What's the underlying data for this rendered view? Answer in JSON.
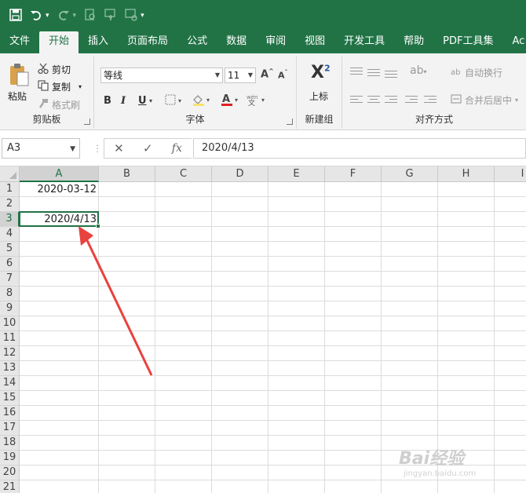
{
  "tabs": [
    "文件",
    "开始",
    "插入",
    "页面布局",
    "公式",
    "数据",
    "审阅",
    "视图",
    "开发工具",
    "帮助",
    "PDF工具集",
    "Ac"
  ],
  "active_tab": "开始",
  "clipboard": {
    "paste": "粘贴",
    "cut": "剪切",
    "copy": "复制",
    "format_painter": "格式刷",
    "label": "剪贴板"
  },
  "font": {
    "name": "等线",
    "size": "11",
    "bold": "B",
    "italic": "I",
    "underline": "U",
    "label": "字体"
  },
  "new_group": {
    "superscript": "上标",
    "label": "新建组"
  },
  "alignment": {
    "wrap_text": "自动换行",
    "merge_center": "合并后居中",
    "label": "对齐方式"
  },
  "formula_bar": {
    "name_box": "A3",
    "cancel_glyph": "✕",
    "enter_glyph": "✓",
    "fx_glyph": "fx",
    "value": "2020/4/13"
  },
  "columns": [
    "A",
    "B",
    "C",
    "D",
    "E",
    "F",
    "G",
    "H",
    "I"
  ],
  "selected_column": "A",
  "rows": [
    "1",
    "2",
    "3",
    "4",
    "5",
    "6",
    "7",
    "8",
    "9",
    "10",
    "11",
    "12",
    "13",
    "14",
    "15",
    "16",
    "17",
    "18",
    "19",
    "20",
    "21"
  ],
  "selected_row": "3",
  "cells": {
    "A1": "2020-03-12",
    "A3": "2020/4/13"
  },
  "watermark": {
    "text": "Bai经验",
    "sub": "jingyan.baidu.com"
  },
  "colors": {
    "excel_green": "#217346",
    "arrow_red": "#e8423f"
  }
}
